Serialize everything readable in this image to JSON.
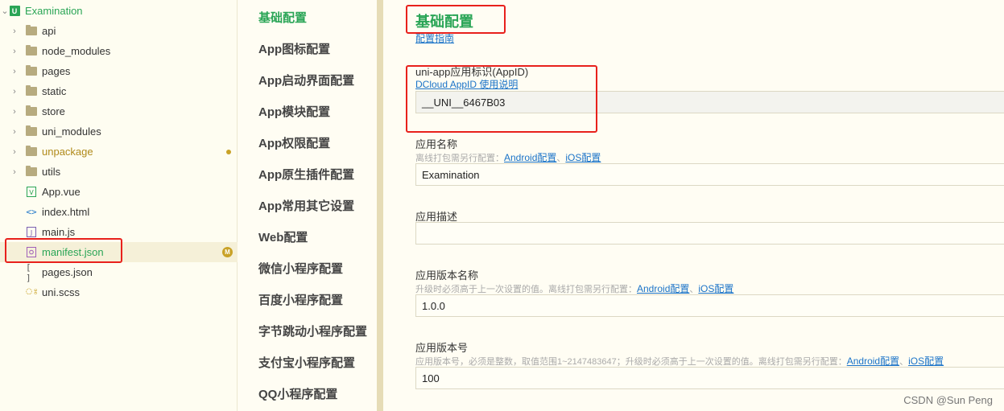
{
  "tree": {
    "project": "Examination",
    "items": [
      {
        "label": "api",
        "type": "folder",
        "icon": "folder-icon"
      },
      {
        "label": "node_modules",
        "type": "folder",
        "icon": "folder-icon"
      },
      {
        "label": "pages",
        "type": "folder",
        "icon": "folder-icon"
      },
      {
        "label": "static",
        "type": "folder",
        "icon": "folder-icon"
      },
      {
        "label": "store",
        "type": "folder",
        "icon": "folder-icon"
      },
      {
        "label": "uni_modules",
        "type": "folder",
        "icon": "folder-icon"
      },
      {
        "label": "unpackage",
        "type": "folder",
        "icon": "folder-icon",
        "status": "modified-dot"
      },
      {
        "label": "utils",
        "type": "folder",
        "icon": "folder-icon"
      },
      {
        "label": "App.vue",
        "type": "file",
        "icon": "vue-file-icon"
      },
      {
        "label": "index.html",
        "type": "file",
        "icon": "html-file-icon"
      },
      {
        "label": "main.js",
        "type": "file",
        "icon": "js-file-icon"
      },
      {
        "label": "manifest.json",
        "type": "file",
        "icon": "manifest-file-icon",
        "badge": "M"
      },
      {
        "label": "pages.json",
        "type": "file",
        "icon": "json-file-icon"
      },
      {
        "label": "uni.scss",
        "type": "file",
        "icon": "scss-file-icon"
      }
    ]
  },
  "nav": {
    "items": [
      "基础配置",
      "App图标配置",
      "App启动界面配置",
      "App模块配置",
      "App权限配置",
      "App原生插件配置",
      "App常用其它设置",
      "Web配置",
      "微信小程序配置",
      "百度小程序配置",
      "字节跳动小程序配置",
      "支付宝小程序配置",
      "QQ小程序配置"
    ]
  },
  "main": {
    "title": "基础配置",
    "guide_link": "配置指南",
    "appid": {
      "label": "uni-app应用标识(AppID)",
      "link": "DCloud AppID 使用说明",
      "value": "__UNI__6467B03"
    },
    "app_name": {
      "label": "应用名称",
      "hint": "离线打包需另行配置：",
      "link_android": "Android配置",
      "sep": "、",
      "link_ios": "iOS配置",
      "value": "Examination"
    },
    "app_desc": {
      "label": "应用描述",
      "value": ""
    },
    "version_name": {
      "label": "应用版本名称",
      "hint": "升级时必须高于上一次设置的值。离线打包需另行配置：",
      "link_android": "Android配置",
      "sep": "、",
      "link_ios": "iOS配置",
      "value": "1.0.0"
    },
    "version_code": {
      "label": "应用版本号",
      "hint": "应用版本号，必须是整数，取值范围1~2147483647；升级时必须高于上一次设置的值。离线打包需另行配置：",
      "link_android": "Android配置",
      "sep": "、",
      "link_ios": "iOS配置",
      "value": "100"
    }
  },
  "watermark": "CSDN @Sun   Peng",
  "colors": {
    "accent": "#2aa556",
    "link": "#1a73c8",
    "highlight_box": "#e8211c",
    "modified": "#c9a227"
  }
}
